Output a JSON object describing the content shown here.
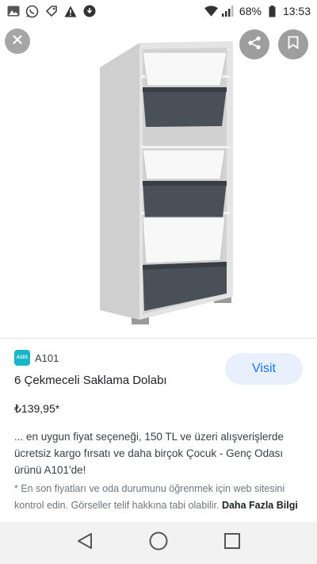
{
  "status_bar": {
    "battery": "68%",
    "time": "13:53",
    "icons": [
      "photo-icon",
      "whatsapp-icon",
      "tag-icon",
      "warning-icon",
      "notification-icon",
      "wifi-icon",
      "signal-icon",
      "battery-icon"
    ]
  },
  "image_viewer": {
    "icons": [
      "close-icon",
      "share-icon",
      "bookmark-icon"
    ]
  },
  "product": {
    "source": "A101",
    "source_logo_text": "A101",
    "title": "6 Çekmeceli Saklama Dolabı",
    "price": "₺139,95*",
    "visit_label": "Visit",
    "description": "... en uygun fiyat seçeneği, 150 TL ve üzeri alışverişlerde ücretsiz kargo fırsatı ve daha birçok Çocuk - Genç Odası ürünü A101'de!",
    "disclaimer": "* En son fiyatları ve oda durumunu öğrenmek için web sitesini kontrol edin. Görseller telif hakkına tabi olabilir.",
    "more_label": "Daha Fazla Bilgi"
  },
  "nav_bar": {
    "icons": [
      "back-icon",
      "home-icon",
      "recents-icon"
    ]
  },
  "colors": {
    "accent": "#1a73e8",
    "visit_bg": "#e8f0fe",
    "drawer_light": "#f4f4f4",
    "drawer_dark": "#4a5058",
    "cabinet": "#e6e6e6"
  }
}
